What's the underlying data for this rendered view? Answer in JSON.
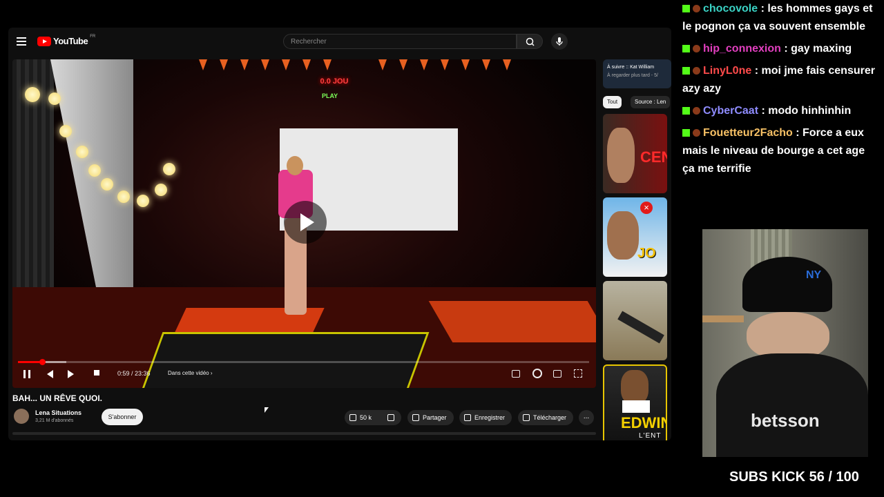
{
  "youtube": {
    "logo_text": "YouTube",
    "country_code": "FR",
    "search_placeholder": "Rechercher",
    "player": {
      "time": "0:59 / 23:36",
      "chapter_label": "Dans cette vidéo",
      "progress_fraction": 0.042,
      "neon_sign": "0.0 JOU",
      "neon_sign_2": "PLAY"
    },
    "video_title": "BAH... UN RÊVE QUOI.",
    "channel": {
      "name": "Lena Situations",
      "subscribers": "3,21 M d'abonnés",
      "subscribe_label": "S'abonner"
    },
    "actions": {
      "likes": "50 k",
      "share": "Partager",
      "save": "Enregistrer",
      "download": "Télécharger",
      "more": "..."
    },
    "sidebar": {
      "up_next": "À suivre :: Kat William",
      "up_next_sub": "À regarder plus tard - 5/",
      "chips": [
        "Tout",
        "Source : Len"
      ],
      "thumb_texts": [
        "CEN",
        "JO",
        "",
        "EDWIN",
        "L'ENT"
      ]
    }
  },
  "chat": [
    {
      "user": "chocovole",
      "text": ": les hommes gays et le pognon ça va souvent ensemble",
      "color": "#3ad3c5"
    },
    {
      "user": "hip_connexion",
      "text": ": gay maxing",
      "color": "#e23fbf"
    },
    {
      "user": "LinyL0ne",
      "text": ": moi jme fais censurer azy azy",
      "color": "#ff4b4b"
    },
    {
      "user": "CyberCaat",
      "text": ": modo hinhinhin",
      "color": "#8f8cff"
    },
    {
      "user": "Fouetteur2Facho",
      "text": ": Force a eux mais le niveau de bourge a cet age ça me terrifie",
      "color": "#f6c065"
    }
  ],
  "overlay": {
    "subs_kick": "SUBS KICK 56 / 100"
  },
  "colors": {
    "kick_green": "#53fc18",
    "youtube_red": "#ff0000"
  }
}
